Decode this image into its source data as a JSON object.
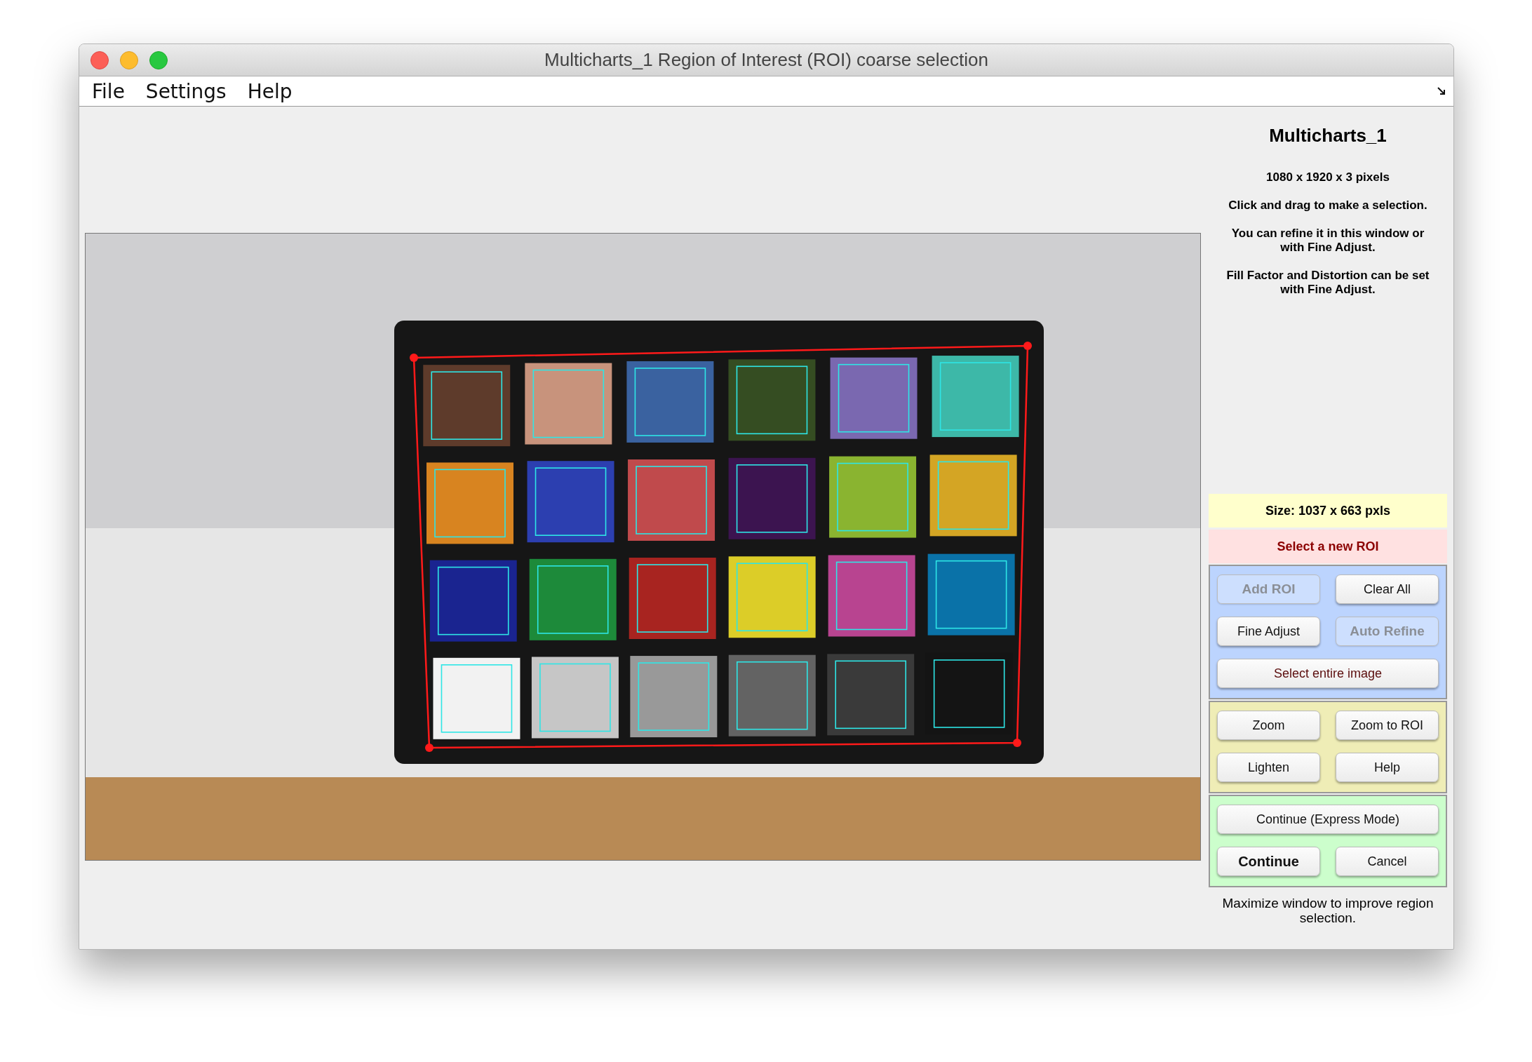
{
  "window": {
    "title": "Multicharts_1 Region of Interest (ROI) coarse selection"
  },
  "menu": [
    {
      "label": "File"
    },
    {
      "label": "Settings"
    },
    {
      "label": "Help"
    }
  ],
  "panel": {
    "title": "Multicharts_1",
    "dimensions": "1080 x 1920 x 3  pixels",
    "instructions": [
      "Click and drag to make a selection.",
      "You can refine it in this window or with Fine Adjust.",
      "Fill Factor and Distortion can be set with Fine Adjust."
    ],
    "size": "Size:  1037 x 663 pxls",
    "status": "Select a new ROI",
    "groups": [
      {
        "kind": "selection",
        "rows": [
          [
            {
              "label": "Add ROI",
              "disabled": true,
              "kind": "normal"
            },
            {
              "label": "Clear All",
              "disabled": false,
              "kind": "normal"
            }
          ],
          [
            {
              "label": "Fine Adjust",
              "disabled": false,
              "kind": "normal"
            },
            {
              "label": "Auto Refine",
              "disabled": true,
              "kind": "normal"
            }
          ],
          [
            {
              "label": "Select entire image",
              "disabled": false,
              "kind": "accent"
            }
          ]
        ]
      },
      {
        "kind": "view",
        "rows": [
          [
            {
              "label": "Zoom",
              "disabled": false,
              "kind": "normal"
            },
            {
              "label": "Zoom to ROI",
              "disabled": false,
              "kind": "normal"
            }
          ],
          [
            {
              "label": "Lighten",
              "disabled": false,
              "kind": "normal"
            },
            {
              "label": "Help",
              "disabled": false,
              "kind": "normal"
            }
          ]
        ]
      },
      {
        "kind": "finish",
        "rows": [
          [
            {
              "label": "Continue (Express Mode)",
              "disabled": false,
              "kind": "normal"
            }
          ],
          [
            {
              "label": "Continue",
              "disabled": false,
              "kind": "default"
            },
            {
              "label": "Cancel",
              "disabled": false,
              "kind": "normal"
            }
          ]
        ]
      }
    ],
    "footer": "Maximize window to improve region selection."
  }
}
